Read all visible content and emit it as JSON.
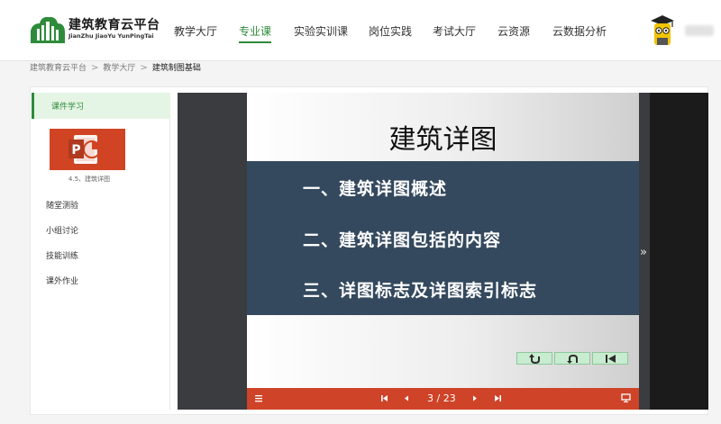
{
  "header": {
    "logo_title": "建筑教育云平台",
    "logo_subtitle": "JianZhu JiaoYu YunPingTai",
    "nav": [
      {
        "label": "教学大厅",
        "active": false
      },
      {
        "label": "专业课",
        "active": true
      },
      {
        "label": "实验实训课",
        "active": false
      },
      {
        "label": "岗位实践",
        "active": false
      },
      {
        "label": "考试大厅",
        "active": false
      },
      {
        "label": "云资源",
        "active": false
      },
      {
        "label": "云数据分析",
        "active": false
      }
    ],
    "accent_color": "#2e8b3a"
  },
  "breadcrumb": {
    "items": [
      "建筑教育云平台",
      "教学大厅",
      "建筑制图基础"
    ],
    "separator": ">"
  },
  "sidebar": {
    "section_title": "课件学习",
    "courseware": {
      "caption": "4.5、建筑详图",
      "icon": "powerpoint-icon"
    },
    "items": [
      "随堂测验",
      "小组讨论",
      "技能训练",
      "课外作业"
    ]
  },
  "slide": {
    "title": "建筑详图",
    "lines": [
      "一、建筑详图概述",
      "二、建筑详图包括的内容",
      "三、详图标志及详图索引标志"
    ],
    "band_color": "#34495e",
    "buttons": [
      "return-icon",
      "back-icon",
      "first-slide-icon"
    ]
  },
  "viewer": {
    "page_indicator": "3 / 23",
    "toolbar_color": "#cf4328",
    "icons": [
      "menu-icon",
      "first-page-icon",
      "prev-page-icon",
      "next-page-icon",
      "last-page-icon",
      "present-icon",
      "expand-icon"
    ]
  }
}
